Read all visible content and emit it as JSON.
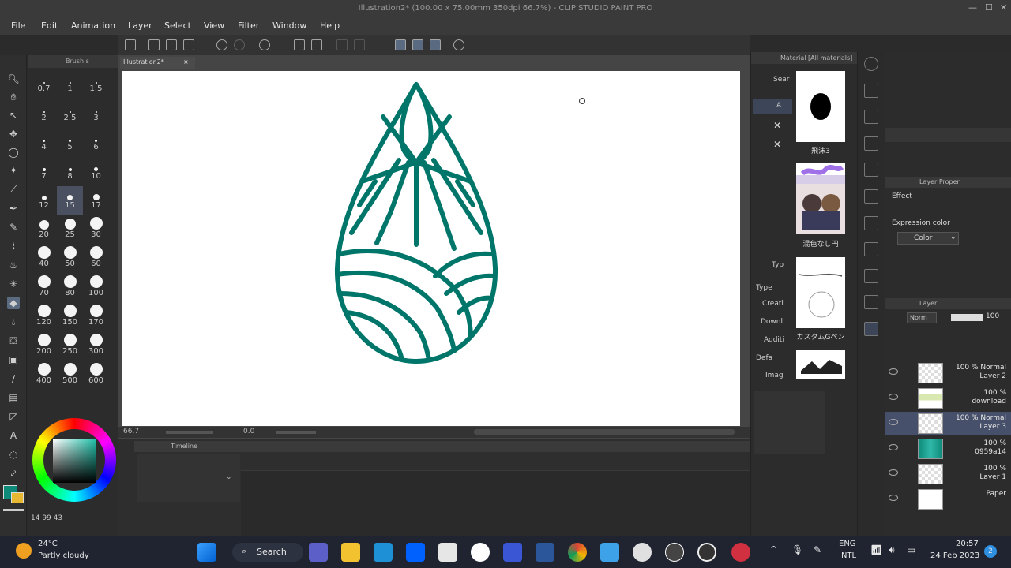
{
  "window": {
    "title": "Illustration2* (100.00 x 75.00mm 350dpi 66.7%) - CLIP STUDIO PAINT PRO"
  },
  "menu": [
    "File",
    "Edit",
    "Animation",
    "Layer",
    "Select",
    "View",
    "Filter",
    "Window",
    "Help"
  ],
  "brush_panel": {
    "tab_label": "Brush s",
    "sizes": [
      "0.7",
      "1",
      "1.5",
      "2",
      "2.5",
      "3",
      "4",
      "5",
      "6",
      "7",
      "8",
      "10",
      "12",
      "15",
      "17",
      "20",
      "25",
      "30",
      "40",
      "50",
      "60",
      "70",
      "80",
      "100",
      "120",
      "150",
      "170",
      "200",
      "250",
      "300",
      "400",
      "500",
      "600"
    ],
    "selected_size": "15"
  },
  "canvas": {
    "tab_label": "Illustration2*",
    "zoom": "66.7",
    "rotation": "0.0",
    "drawing_color": "#00766a"
  },
  "timeline": {
    "label": "Timeline"
  },
  "material_panel": {
    "header": "Material [All materials]",
    "search_label": "Sear",
    "folder_label": "A",
    "type_section": "Typ",
    "type_label": "Type",
    "buttons": [
      "Creati",
      "Downl",
      "Additi",
      "Defa",
      "Imag"
    ],
    "items": [
      {
        "label": "飛沫3"
      },
      {
        "label": "混色なし円"
      },
      {
        "label": "カスタムGペン"
      }
    ]
  },
  "layer_property": {
    "header": "Layer Proper",
    "effect_label": "Effect",
    "expression_color_label": "Expression color",
    "expression_color_value": "Color"
  },
  "layer_panel": {
    "header": "Layer",
    "blend_mode": "Norm",
    "opacity": "100",
    "layers": [
      {
        "line1": "100 % Normal",
        "line2": "Layer 2",
        "selected": false
      },
      {
        "line1": "100 %",
        "line2": "download",
        "selected": false
      },
      {
        "line1": "100 % Normal",
        "line2": "Layer 3",
        "selected": true
      },
      {
        "line1": "100 %",
        "line2": "0959a14",
        "selected": false
      },
      {
        "line1": "100 %",
        "line2": "Layer 1",
        "selected": false
      },
      {
        "line1": "",
        "line2": "Paper",
        "selected": false
      }
    ]
  },
  "color_panel": {
    "main_color": "#0f8a7a",
    "sub_color": "#e8b830",
    "hsv_readout": [
      "14",
      "99",
      "43"
    ]
  },
  "taskbar": {
    "weather_temp": "24°C",
    "weather_desc": "Partly cloudy",
    "search_label": "Search",
    "lang_line1": "ENG",
    "lang_line2": "INTL",
    "time": "20:57",
    "date": "24 Feb 2023",
    "notification_count": "2"
  }
}
